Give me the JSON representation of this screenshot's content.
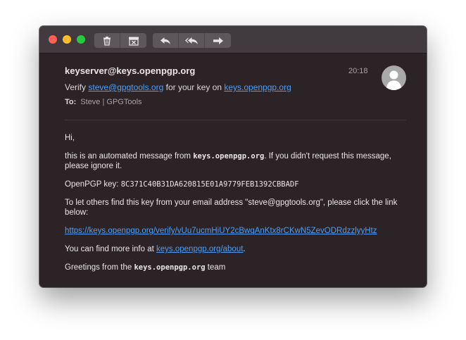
{
  "toolbar": {
    "delete_icon": "trash-icon",
    "archive_icon": "archive-icon",
    "reply_icon": "reply-icon",
    "reply_all_icon": "reply-all-icon",
    "forward_icon": "forward-icon"
  },
  "message": {
    "sender": "keyserver@keys.openpgp.org",
    "time": "20:18",
    "subject_prefix": "Verify",
    "subject_email": "steve@gpgtools.org",
    "subject_middle": "for your key on",
    "subject_domain": "keys.openpgp.org",
    "to_label": "To:",
    "to_value": "Steve | GPGTools"
  },
  "body": {
    "greeting": "Hi,",
    "line1_a": "this is an automated message from",
    "line1_domain": "keys.openpgp.org",
    "line1_b": ". If you didn't request this message, please ignore it.",
    "key_label": "OpenPGP key:",
    "key_fingerprint": "8C371C40B31DA620815E01A9779FEB1392CBBADF",
    "instructions": "To let others find this key from your email address \"steve@gpgtools.org\", please click the link below:",
    "verify_link": "https://keys.openpgp.org/verify/vUu7ucmHiUY2cBwqAnKtx8rCKwN5ZevODRdzzlyyHtz",
    "more_info_a": "You can find more info at",
    "more_info_link": "keys.openpgp.org/about",
    "more_info_b": ".",
    "closing_a": "Greetings from the",
    "closing_domain": "keys.openpgp.org",
    "closing_b": "team"
  }
}
